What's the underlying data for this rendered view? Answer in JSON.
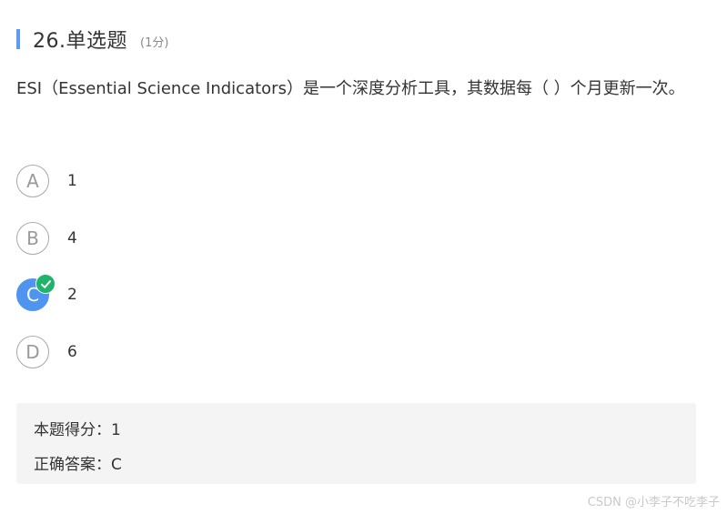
{
  "question": {
    "title": "26.单选题",
    "score": "(1分)",
    "text": "ESI（Essential Science Indicators）是一个深度分析工具，其数据每（    ）个月更新一次。"
  },
  "options": [
    {
      "letter": "A",
      "text": "1",
      "selected": false
    },
    {
      "letter": "B",
      "text": "4",
      "selected": false
    },
    {
      "letter": "C",
      "text": "2",
      "selected": true
    },
    {
      "letter": "D",
      "text": "6",
      "selected": false
    }
  ],
  "result": {
    "score_line": "本题得分：1",
    "answer_line": "正确答案：C"
  },
  "watermark": "CSDN @小李子不吃李子",
  "colors": {
    "accent": "#5b9bf2",
    "selected": "#4f95f0",
    "correct": "#1fb46a",
    "panel": "#f4f4f4"
  },
  "icons": {
    "correct_badge": "check-circle-icon"
  }
}
